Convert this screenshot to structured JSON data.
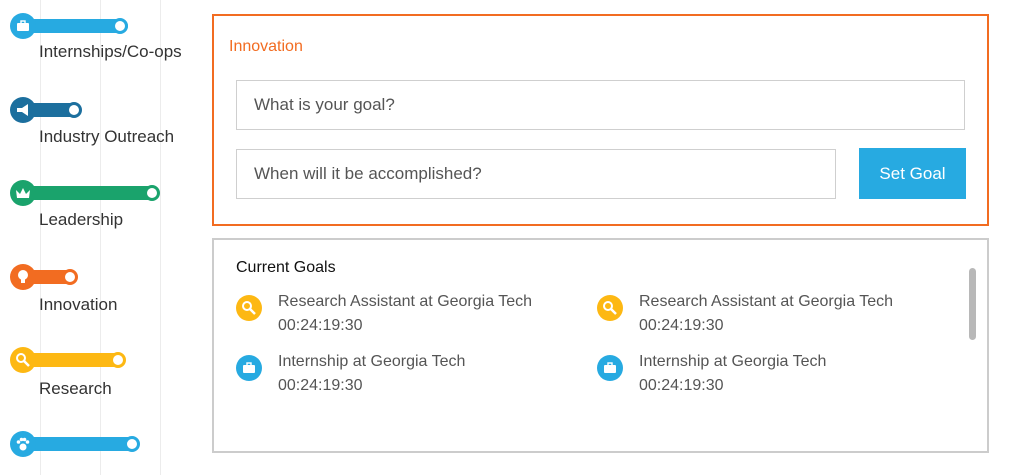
{
  "colors": {
    "accent": "#f26c21",
    "button": "#27aae1",
    "internships": "#27aae1",
    "industry": "#1c6f9e",
    "leadership": "#1aa36c",
    "innovation": "#f26c21",
    "research": "#fdb813",
    "last": "#27aae1"
  },
  "sidebar": {
    "items": [
      {
        "label": "Internships/Co-ops",
        "icon": "briefcase-icon"
      },
      {
        "label": "Industry Outreach",
        "icon": "megaphone-icon"
      },
      {
        "label": "Leadership",
        "icon": "crown-icon"
      },
      {
        "label": "Innovation",
        "icon": "lightbulb-icon"
      },
      {
        "label": "Research",
        "icon": "magnifier-icon"
      },
      {
        "label": "",
        "icon": "paw-icon"
      }
    ]
  },
  "goal_form": {
    "title": "Innovation",
    "goal_placeholder": "What is your goal?",
    "date_placeholder": "When will it be accomplished?",
    "submit_label": "Set Goal"
  },
  "current_goals": {
    "title": "Current Goals",
    "items": [
      {
        "title": "Research Assistant at Georgia Tech",
        "time": "00:24:19:30",
        "icon": "magnifier-icon"
      },
      {
        "title": "Research Assistant at Georgia Tech",
        "time": "00:24:19:30",
        "icon": "magnifier-icon"
      },
      {
        "title": "Internship at Georgia Tech",
        "time": "00:24:19:30",
        "icon": "briefcase-icon"
      },
      {
        "title": "Internship at Georgia Tech",
        "time": "00:24:19:30",
        "icon": "briefcase-icon"
      }
    ]
  }
}
